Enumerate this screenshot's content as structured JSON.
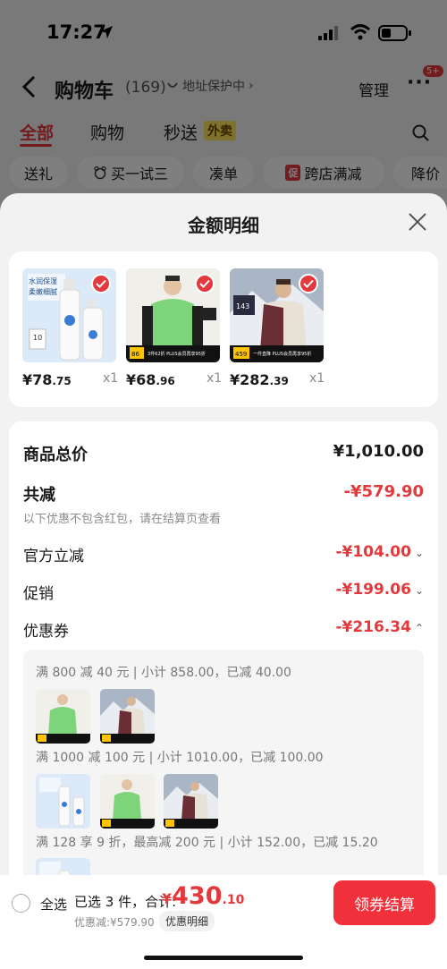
{
  "status": {
    "time": "17:27"
  },
  "nav": {
    "title": "购物车",
    "count": "(169)",
    "addr_protect": "地址保护中",
    "manage": "管理",
    "more": "···",
    "badge": "5+"
  },
  "tabs": [
    {
      "label": "全部",
      "active": true
    },
    {
      "label": "购物"
    },
    {
      "label": "秒送"
    }
  ],
  "tabs_extra": {
    "waimai": "外卖"
  },
  "chips": [
    "送礼",
    "买一试三",
    "凑单",
    "跨店满减",
    "降价"
  ],
  "chip_tag": "促",
  "sheet": {
    "title": "金额明细",
    "products": [
      {
        "price_main": "¥78",
        "price_cents": ".75",
        "qty": "x1"
      },
      {
        "price_main": "¥68",
        "price_cents": ".96",
        "qty": "x1"
      },
      {
        "price_main": "¥282",
        "price_cents": ".39",
        "qty": "x1"
      }
    ],
    "total_label": "商品总价",
    "total_value": "¥1,010.00",
    "reduce_label": "共减",
    "reduce_value": "-¥579.90",
    "reduce_note": "以下优惠不包含红包，请在结算页查看",
    "official_label": "官方立减",
    "official_value": "-¥104.00",
    "promo_label": "促销",
    "promo_value": "-¥199.06",
    "coupon_label": "优惠券",
    "coupon_value": "-¥216.34",
    "coupons": [
      "满 800 减 40 元 | 小计 858.00，已减 40.00",
      "满 1000 减 100 元 | 小计 1010.00，已减 100.00",
      "满 128 享 9 折，最高减 200 元 | 小计 152.00，已减 15.20"
    ],
    "thumb_text": {
      "bottle_line1": "水润保湿",
      "bottle_line2": "柔嫩细腻",
      "shirt_banner": "3件62折 PLUS会员再享95折",
      "shirt_price": "86",
      "jacket_banner": "一件直降 PLUS会员再享95折",
      "jacket_price": "459",
      "jacket_tag": "143"
    }
  },
  "bottom": {
    "select_all": "全选",
    "selected": "已选 3 件，合计:",
    "yen": "¥",
    "total_big": "430",
    "total_small": ".10",
    "discount": "优惠减:¥579.90",
    "detail": "优惠明细",
    "checkout": "领券结算"
  },
  "colors": {
    "accent": "#e4393c",
    "checkout": "#f0303a",
    "waimai": "#ffe55a"
  }
}
